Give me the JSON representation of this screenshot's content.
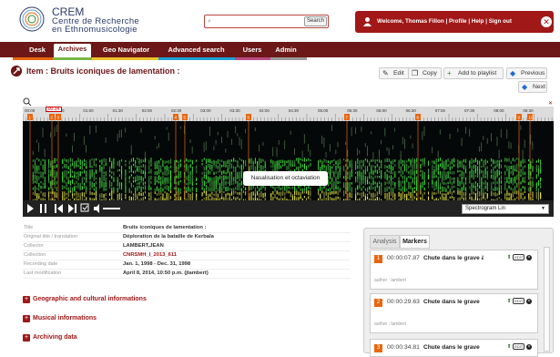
{
  "header": {
    "logo_title": "CREM",
    "logo_sub1": "Centre de Recherche",
    "logo_sub2": "en Ethnomusicologie",
    "search_placeholder": "",
    "search_button": "Search",
    "user_text": "Welcome, Thomas Fillon | Profile | Help | Sign out"
  },
  "nav": {
    "items": [
      "Desk",
      "Archives",
      "Geo Navigator",
      "Advanced search",
      "Users",
      "Admin"
    ]
  },
  "page": {
    "title": "Item : Bruits iconiques de lamentation :"
  },
  "actions": {
    "edit": "Edit",
    "copy": "Copy",
    "add": "Add to playlist",
    "previous": "Previous",
    "next": "Next"
  },
  "player": {
    "time": "00:34",
    "ruler_labels": [
      "00:00",
      "00:30",
      "01:00",
      "01:30",
      "02:00",
      "02:30",
      "03:00",
      "03:30",
      "04:00",
      "04:30",
      "05:00",
      "05:30",
      "06:00",
      "06:30",
      "07:00",
      "07:30",
      "08:00",
      "08:30"
    ],
    "markers": [
      "1",
      "2",
      "3",
      "4",
      "5",
      "6",
      "7",
      "8",
      "9",
      "10",
      "11"
    ],
    "tooltip": "Nasalisation et octaviation",
    "select": "Spectrogram Lin"
  },
  "meta": [
    {
      "label": "Title",
      "value": "Bruits iconiques de lamentation :"
    },
    {
      "label": "Original title / translation",
      "value": "Déploration de la bataille de Kerbala"
    },
    {
      "label": "Collector",
      "value": "LAMBERT,JEAN"
    },
    {
      "label": "Collection",
      "value": "CNRSMH_I_2013_611"
    },
    {
      "label": "Recording date",
      "value": "Jan. 1, 1998 - Dec. 31, 1998"
    },
    {
      "label": "Last modification",
      "value": "April 8, 2014, 10:50 p.m. (jlambert)"
    }
  ],
  "sections": [
    "Geographic and cultural informations",
    "Musical informations",
    "Archiving data"
  ],
  "panel": {
    "tabs": [
      "Analysis",
      "Markers"
    ],
    "markers": [
      {
        "num": "1",
        "time": "00:00:07.87",
        "title": "Chute dans le grave à la f",
        "author": "author : lambert"
      },
      {
        "num": "2",
        "time": "00:00:29.63",
        "title": "Chute dans le grave",
        "author": "author : lambert"
      },
      {
        "num": "3",
        "time": "00:00:34.81",
        "title": "Chute dans le grave",
        "author": ""
      }
    ],
    "edit_label": "EDIT"
  },
  "colors": {
    "brand": "#6c1818",
    "accent": "#e8670f",
    "header_red": "#a01818"
  }
}
